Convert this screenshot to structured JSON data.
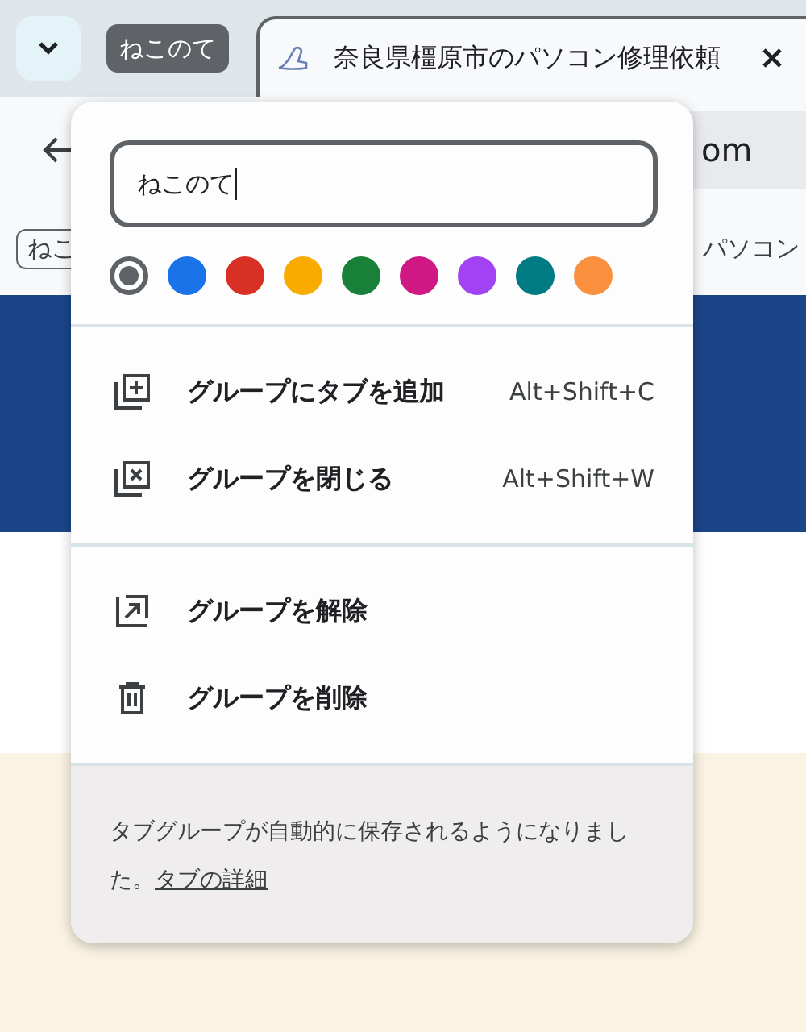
{
  "tab_strip": {
    "group_chip": "ねこのて",
    "tab": {
      "title": "奈良県橿原市のパソコン修理依頼"
    }
  },
  "toolbar": {
    "address_text": "om"
  },
  "bookmarks_bar": {
    "items": [
      "ねこ",
      "パソコン"
    ]
  },
  "group_editor": {
    "name_field": {
      "value": "ねこのて"
    },
    "colors": [
      {
        "color": "#5f6368",
        "selected": true
      },
      {
        "color": "#1a73e8",
        "selected": false
      },
      {
        "color": "#d93025",
        "selected": false
      },
      {
        "color": "#f9ab00",
        "selected": false
      },
      {
        "color": "#188038",
        "selected": false
      },
      {
        "color": "#d01884",
        "selected": false
      },
      {
        "color": "#a142f4",
        "selected": false
      },
      {
        "color": "#007b83",
        "selected": false
      },
      {
        "color": "#fa903e",
        "selected": false
      }
    ],
    "menu_sections": [
      [
        {
          "kind": "add",
          "label": "グループにタブを追加",
          "shortcut": "Alt+Shift+C"
        },
        {
          "kind": "close",
          "label": "グループを閉じる",
          "shortcut": "Alt+Shift+W"
        }
      ],
      [
        {
          "kind": "ungroup",
          "label": "グループを解除"
        },
        {
          "kind": "delete",
          "label": "グループを削除"
        }
      ]
    ],
    "footer": {
      "text": "タブグループが自動的に保存されるようになりました。",
      "link": "タブの詳細"
    }
  }
}
